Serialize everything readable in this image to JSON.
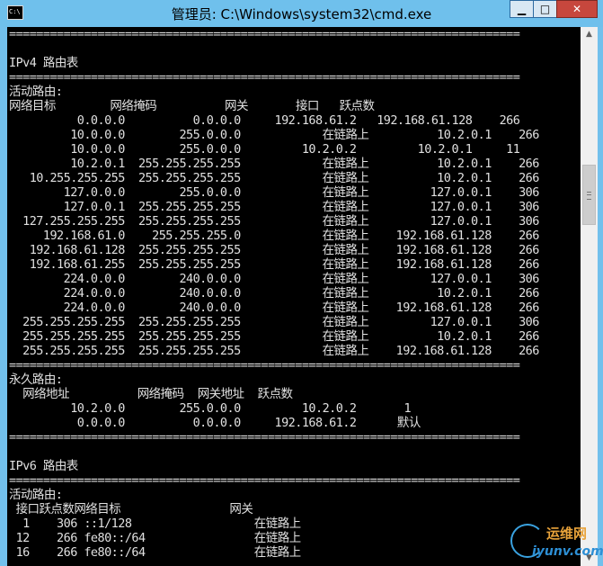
{
  "window": {
    "title": "管理员: C:\\Windows\\system32\\cmd.exe",
    "icon_text": "C:\\",
    "controls": {
      "minimize": "▁",
      "maximize": "□",
      "close": "✕"
    }
  },
  "console": {
    "lines": [
      "===========================================================================",
      "",
      "IPv4 路由表",
      "===========================================================================",
      "活动路由:",
      "网络目标        网络掩码          网关       接口   跃点数",
      "          0.0.0.0          0.0.0.0     192.168.61.2   192.168.61.128    266",
      "         10.0.0.0        255.0.0.0            在链路上          10.2.0.1    266",
      "         10.0.0.0        255.0.0.0         10.2.0.2         10.2.0.1     11",
      "         10.2.0.1  255.255.255.255            在链路上          10.2.0.1    266",
      "   10.255.255.255  255.255.255.255            在链路上          10.2.0.1    266",
      "        127.0.0.0        255.0.0.0            在链路上         127.0.0.1    306",
      "        127.0.0.1  255.255.255.255            在链路上         127.0.0.1    306",
      "  127.255.255.255  255.255.255.255            在链路上         127.0.0.1    306",
      "     192.168.61.0    255.255.255.0            在链路上    192.168.61.128    266",
      "   192.168.61.128  255.255.255.255            在链路上    192.168.61.128    266",
      "   192.168.61.255  255.255.255.255            在链路上    192.168.61.128    266",
      "        224.0.0.0        240.0.0.0            在链路上         127.0.0.1    306",
      "        224.0.0.0        240.0.0.0            在链路上          10.2.0.1    266",
      "        224.0.0.0        240.0.0.0            在链路上    192.168.61.128    266",
      "  255.255.255.255  255.255.255.255            在链路上         127.0.0.1    306",
      "  255.255.255.255  255.255.255.255            在链路上          10.2.0.1    266",
      "  255.255.255.255  255.255.255.255            在链路上    192.168.61.128    266",
      "===========================================================================",
      "永久路由:",
      "  网络地址          网络掩码  网关地址  跃点数",
      "         10.2.0.0        255.0.0.0         10.2.0.2       1",
      "          0.0.0.0          0.0.0.0     192.168.61.2      默认",
      "===========================================================================",
      "",
      "IPv6 路由表",
      "===========================================================================",
      "活动路由:",
      " 接口跃点数网络目标                网关",
      "  1    306 ::1/128                  在链路上",
      " 12    266 fe80::/64                在链路上",
      " 16    266 fe80::/64                在链路上"
    ]
  },
  "scrollbar": {
    "up_arrow": "▲",
    "down_arrow": "▼"
  },
  "watermark": {
    "brand": "运维网",
    "url": "iyunv.com"
  }
}
